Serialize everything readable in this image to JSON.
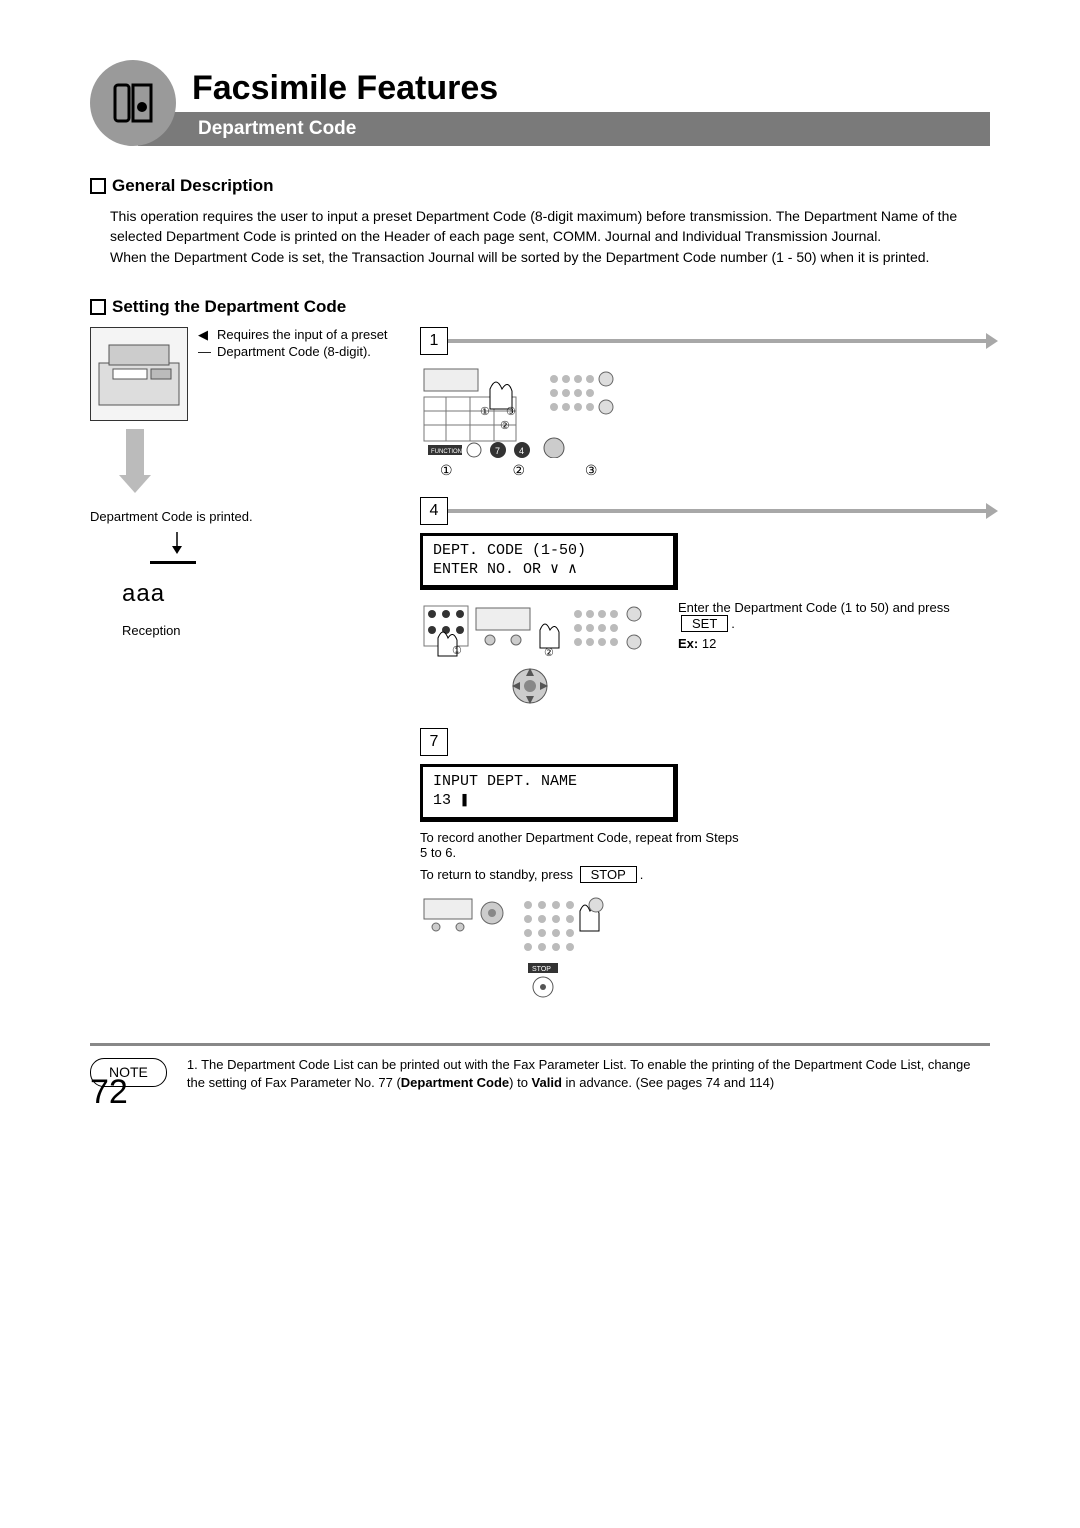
{
  "header": {
    "title": "Facsimile Features",
    "subtitle": "Department Code"
  },
  "sections": {
    "general": {
      "heading": "General Description",
      "body": "This operation requires the user to input a preset Department Code (8-digit maximum) before transmission. The Department Name of the selected Department Code is printed on the Header of each page sent, COMM. Journal and Individual Transmission Journal.\nWhen the Department Code is set, the Transaction Journal will be sorted by the Department Code number (1 - 50) when it is printed."
    },
    "setting": {
      "heading": "Setting the Department Code"
    }
  },
  "left": {
    "requires_text": "Requires the input of a preset Department Code (8-digit).",
    "printed_label": "Department Code is printed.",
    "aaa": "aaa",
    "reception": "Reception"
  },
  "steps": {
    "s1": {
      "num": "1",
      "circnums": "①    ②    ③"
    },
    "s4": {
      "num": "4",
      "lcd1": "DEPT. CODE   (1-50)",
      "lcd2": "ENTER NO. OR ∨ ∧",
      "instr_a": "Enter the Department Code (1 to 50) and press",
      "set_btn": "SET",
      "ex_label": "Ex:",
      "ex_val": " 12"
    },
    "s7": {
      "num": "7",
      "lcd1": "INPUT DEPT. NAME",
      "lcd2": "13 ❚",
      "txt1": "To record another Department Code, repeat from Steps 5 to 6.",
      "txt2_a": "To return to standby, press",
      "stop_btn": "STOP"
    }
  },
  "note": {
    "label": "NOTE",
    "text_a": "1. The Department Code List can be printed out with the Fax Parameter List. To enable the printing of the Department Code List, change the setting of Fax Parameter No. 77 (",
    "bold": "Department Code",
    "text_b": ") to ",
    "bold2": "Valid",
    "text_c": " in advance. (See pages 74 and 114)"
  },
  "page_number": "72"
}
